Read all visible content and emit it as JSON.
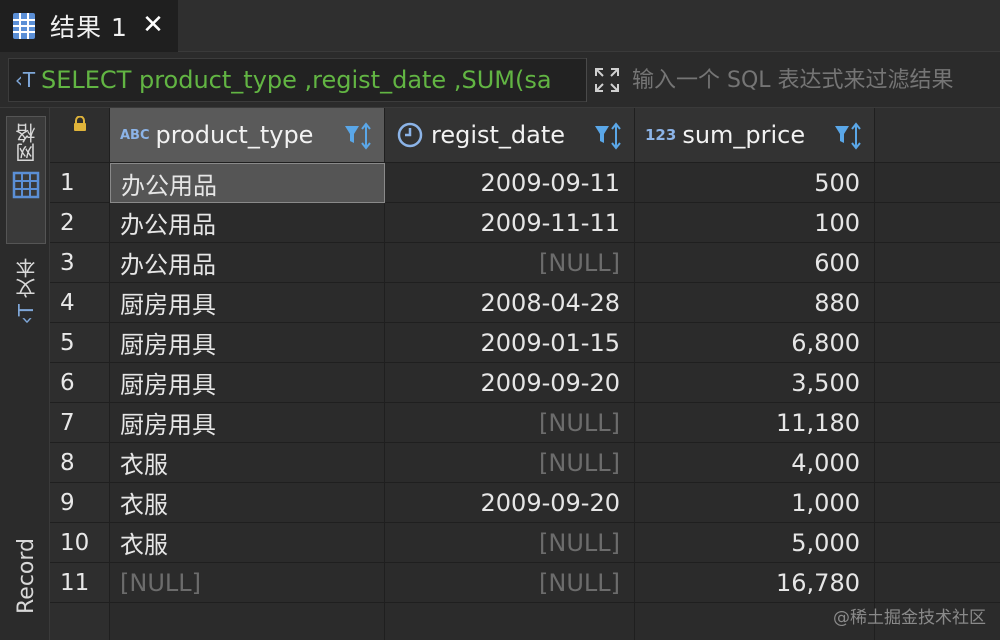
{
  "tab": {
    "title": "结果 1",
    "icon": "table-icon",
    "close_icon": "close-icon"
  },
  "filter": {
    "sql": "SELECT product_type ,regist_date ,SUM(sa",
    "placeholder": "输入一个 SQL 表达式来过滤结果"
  },
  "sidebar": {
    "grid_label": "网格",
    "text_label": "文本",
    "record_label": "Record"
  },
  "columns": [
    {
      "type_badge": "ABC",
      "name": "product_type"
    },
    {
      "type_badge": "clock",
      "name": "regist_date"
    },
    {
      "type_badge": "123",
      "name": "sum_price"
    }
  ],
  "rows": [
    {
      "num": "1",
      "product_type": "办公用品",
      "regist_date": "2009-09-11",
      "sum_price": "500"
    },
    {
      "num": "2",
      "product_type": "办公用品",
      "regist_date": "2009-11-11",
      "sum_price": "100"
    },
    {
      "num": "3",
      "product_type": "办公用品",
      "regist_date": "[NULL]",
      "sum_price": "600"
    },
    {
      "num": "4",
      "product_type": "厨房用具",
      "regist_date": "2008-04-28",
      "sum_price": "880"
    },
    {
      "num": "5",
      "product_type": "厨房用具",
      "regist_date": "2009-01-15",
      "sum_price": "6,800"
    },
    {
      "num": "6",
      "product_type": "厨房用具",
      "regist_date": "2009-09-20",
      "sum_price": "3,500"
    },
    {
      "num": "7",
      "product_type": "厨房用具",
      "regist_date": "[NULL]",
      "sum_price": "11,180"
    },
    {
      "num": "8",
      "product_type": "衣服",
      "regist_date": "[NULL]",
      "sum_price": "4,000"
    },
    {
      "num": "9",
      "product_type": "衣服",
      "regist_date": "2009-09-20",
      "sum_price": "1,000"
    },
    {
      "num": "10",
      "product_type": "衣服",
      "regist_date": "[NULL]",
      "sum_price": "5,000"
    },
    {
      "num": "11",
      "product_type": "[NULL]",
      "regist_date": "[NULL]",
      "sum_price": "16,780"
    }
  ],
  "watermark": "@稀土掘金技术社区",
  "colors": {
    "sql_text": "#62b543",
    "null_text": "#6c6c6c",
    "icon_blue": "#7fa7d8"
  }
}
